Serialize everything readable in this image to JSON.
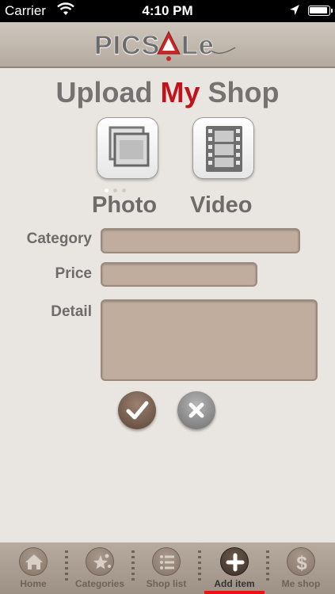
{
  "status_bar": {
    "carrier": "Carrier",
    "time": "4:10 PM"
  },
  "header": {
    "logo_text": "PICSALe"
  },
  "page": {
    "title_prefix": "Upload ",
    "title_highlight": "My",
    "title_suffix": " Shop"
  },
  "upload": {
    "photo_label": "Photo",
    "video_label": "Video"
  },
  "form": {
    "category_label": "Category",
    "category_value": "",
    "price_label": "Price",
    "price_value": "",
    "detail_label": "Detail",
    "detail_value": ""
  },
  "tabs": [
    {
      "label": "Home",
      "icon": "home-icon"
    },
    {
      "label": "Categories",
      "icon": "categories-icon"
    },
    {
      "label": "Shop list",
      "icon": "list-icon"
    },
    {
      "label": "Add item",
      "icon": "plus-icon",
      "active": true
    },
    {
      "label": "Me shop",
      "icon": "dollar-icon"
    }
  ],
  "colors": {
    "accent_red": "#c0141c",
    "field_fill": "#c0ad9e",
    "header_bg": "#b4aa9f",
    "tab_active_indicator": "#ee1111"
  }
}
